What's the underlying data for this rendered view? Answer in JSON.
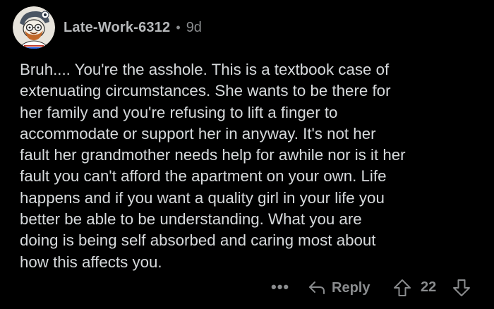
{
  "comment": {
    "author": "Late-Work-6312",
    "separator": "•",
    "age": "9d",
    "body": "Bruh....  You're the asshole.  This is a textbook case of\nextenuating circumstances.  She wants to be there for\nher family and you're refusing to lift a finger to\naccommodate or support her in anyway.  It's not her\nfault her grandmother needs help for awhile nor is it her\nfault you can't afford the apartment on your own.  Life\nhappens and if you want a quality girl in your life you\nbetter be able to be understanding.  What you are\ndoing is being self absorbed and caring most about\nhow this affects you.",
    "score": "22"
  },
  "actions": {
    "more_label": "•••",
    "reply_label": "Reply",
    "reply_icon": "reply-arrow-icon",
    "upvote_icon": "upvote-arrow-icon",
    "downvote_icon": "downvote-arrow-icon",
    "more_icon": "more-options-icon"
  },
  "colors": {
    "background": "#000000",
    "text": "#d7dadc",
    "muted": "#8a8c8e"
  }
}
